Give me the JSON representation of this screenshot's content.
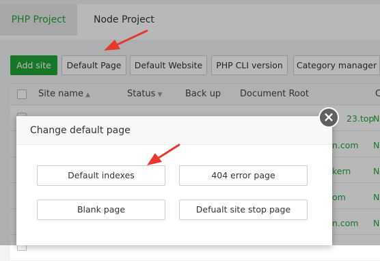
{
  "tabs": [
    {
      "label": "PHP Project",
      "active": true
    },
    {
      "label": "Node Project",
      "active": false
    }
  ],
  "toolbar": {
    "add_site": "Add site",
    "default_page": "Default Page",
    "default_website": "Default Website",
    "php_cli_version": "PHP CLI version",
    "category_manager": "Category manager"
  },
  "table": {
    "headers": {
      "site_name": "Site name",
      "status": "Status",
      "back_up": "Back up",
      "document_root": "Document Root",
      "partial": "C"
    },
    "rows": [
      {
        "partial_root": "23.top",
        "edge": "N"
      },
      {
        "partial_root": "n.com",
        "edge": "N"
      },
      {
        "partial_root": "kern",
        "edge": "N"
      },
      {
        "partial_root": "om",
        "edge": "N"
      },
      {
        "partial_root": "n.com",
        "edge": "N"
      }
    ]
  },
  "modal": {
    "title": "Change default page",
    "buttons": {
      "default_indexes": "Default indexes",
      "error_404": "404 error page",
      "blank_page": "Blank page",
      "site_stop_page": "Defualt site stop page"
    },
    "close_glyph": "×"
  },
  "colors": {
    "accent": "#20a53a",
    "arrow": "#e8372d",
    "overlay": "rgba(0,0,0,0.28)"
  }
}
